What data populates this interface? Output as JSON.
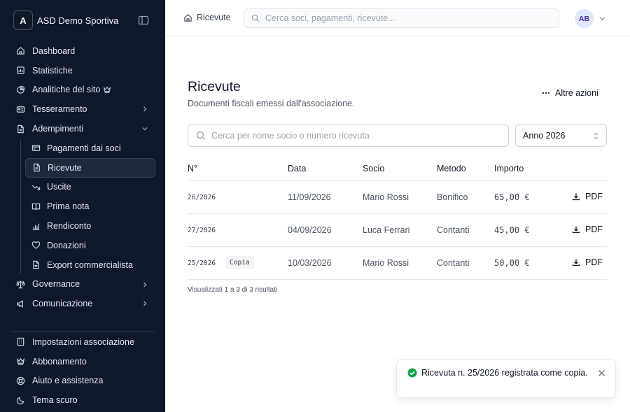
{
  "sidebar": {
    "org_initial": "A",
    "org_name": "ASD Demo Sportiva",
    "items": [
      {
        "label": "Dashboard",
        "icon": "home-icon"
      },
      {
        "label": "Statistiche",
        "icon": "chart-icon"
      },
      {
        "label": "Analitiche del sito",
        "icon": "analytics-icon"
      },
      {
        "label": "Tesseramento",
        "icon": "id-card-icon"
      },
      {
        "label": "Adempimenti",
        "icon": "document-icon"
      }
    ],
    "sub_items": [
      {
        "label": "Pagamenti dai soci",
        "icon": "credit-card-icon"
      },
      {
        "label": "Ricevute",
        "icon": "receipt-icon"
      },
      {
        "label": "Uscite",
        "icon": "trending-down-icon"
      },
      {
        "label": "Prima nota",
        "icon": "book-icon"
      },
      {
        "label": "Rendiconto",
        "icon": "bar-chart-icon"
      },
      {
        "label": "Donazioni",
        "icon": "heart-icon"
      },
      {
        "label": "Export commercialista",
        "icon": "file-export-icon"
      }
    ],
    "items_after": [
      {
        "label": "Governance",
        "icon": "scale-icon"
      },
      {
        "label": "Comunicazione",
        "icon": "megaphone-icon"
      }
    ],
    "bottom": [
      {
        "label": "Impostazioni associazione",
        "icon": "building-icon"
      },
      {
        "label": "Abbonamento",
        "icon": "crown-icon"
      },
      {
        "label": "Aiuto e assistenza",
        "icon": "lifebuoy-icon"
      },
      {
        "label": "Tema scuro",
        "icon": "moon-icon"
      }
    ]
  },
  "header": {
    "breadcrumb": "Ricevute",
    "search_placeholder": "Cerca soci, pagamenti, ricevute...",
    "user_initials": "AB"
  },
  "main": {
    "title": "Ricevute",
    "subtitle": "Documenti fiscali emessi dall'associazione.",
    "more_actions": "Altre azioni",
    "search_placeholder": "Cerca per nome socio o numero ricevuta",
    "year": "Anno 2026",
    "columns": [
      "N°",
      "Data",
      "Socio",
      "Metodo",
      "Importo"
    ],
    "rows": [
      {
        "num": "26/2026",
        "badge": "",
        "date": "11/09/2026",
        "member": "Mario Rossi",
        "method": "Bonifico",
        "amount": "65,00 €",
        "action": "PDF"
      },
      {
        "num": "27/2026",
        "badge": "",
        "date": "04/09/2026",
        "member": "Luca Ferrari",
        "method": "Contanti",
        "amount": "45,00 €",
        "action": "PDF"
      },
      {
        "num": "25/2026",
        "badge": "Copia",
        "date": "10/03/2026",
        "member": "Mario Rossi",
        "method": "Contanti",
        "amount": "50,00 €",
        "action": "PDF"
      }
    ],
    "results_text": "Visualizzati 1 a 3 di 3 risultati"
  },
  "toast": {
    "message": "Ricevuta n. 25/2026 registrata come copia."
  },
  "colors": {
    "sidebar_bg": "#0f172a",
    "active_bg": "#1e293b",
    "avatar_bg": "#e0e7ff",
    "success": "#16a34a"
  }
}
